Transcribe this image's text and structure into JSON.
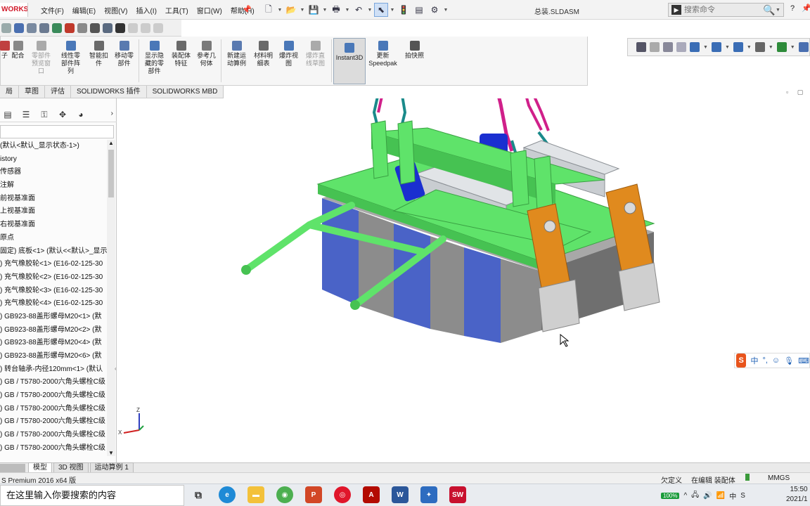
{
  "app": {
    "logo": "WORKS",
    "doc_title": "总装.SLDASM"
  },
  "menu": [
    "文件(F)",
    "编辑(E)",
    "视图(V)",
    "插入(I)",
    "工具(T)",
    "窗口(W)",
    "帮助(H)"
  ],
  "command_search": {
    "placeholder": "搜索命令"
  },
  "help_label": "?",
  "ribbon": {
    "buttons": [
      {
        "label": "子",
        "disabled": false,
        "color": "#c04040"
      },
      {
        "label": "配合",
        "disabled": false,
        "color": "#888888"
      },
      {
        "label": "零部件\n预览窗\n口",
        "disabled": true,
        "color": "#aaaaaa"
      },
      {
        "label": "线性零\n部件阵\n列",
        "disabled": false,
        "color": "#4a78b8"
      },
      {
        "label": "智能扣\n件",
        "disabled": false,
        "color": "#6a6a6a"
      },
      {
        "label": "移动零\n部件",
        "disabled": false,
        "color": "#5a7ab0"
      },
      {
        "label": "显示隐\n藏的零\n部件",
        "disabled": false,
        "color": "#4a78b8"
      },
      {
        "label": "装配体\n特征",
        "disabled": false,
        "color": "#6a6a6a"
      },
      {
        "label": "参考几\n何体",
        "disabled": false,
        "color": "#7a7a7a"
      },
      {
        "label": "新建运\n动算例",
        "disabled": false,
        "color": "#5a7ab0"
      },
      {
        "label": "材料明\n细表",
        "disabled": false,
        "color": "#6a6a6a"
      },
      {
        "label": "爆炸视\n图",
        "disabled": false,
        "color": "#4a78b8"
      },
      {
        "label": "爆炸直\n线草图",
        "disabled": true,
        "color": "#aaaaaa"
      },
      {
        "label": "Instant3D",
        "disabled": false,
        "active": true,
        "color": "#4a78b8"
      },
      {
        "label": "更新\nSpeedpak",
        "disabled": false,
        "color": "#4a78b8"
      },
      {
        "label": "拍快照",
        "disabled": false,
        "color": "#555555"
      }
    ]
  },
  "cm_tabs": [
    "局",
    "草图",
    "评估",
    "SOLIDWORKS 插件",
    "SOLIDWORKS MBD"
  ],
  "feature_tree": [
    "(默认<默认_显示状态-1>)",
    "istory",
    "传感器",
    "注解",
    "前视基准面",
    "上视基准面",
    "右视基准面",
    "原点",
    "固定) 底板<1> (默认<<默认>_显示",
    ") 充气橡胶轮<1> (E16-02-125-30",
    ") 充气橡胶轮<2> (E16-02-125-30",
    ") 充气橡胶轮<3> (E16-02-125-30",
    ") 充气橡胶轮<4> (E16-02-125-30",
    ") GB923-88盖形螺母M20<1> (默",
    ") GB923-88盖形螺母M20<2> (默",
    ") GB923-88盖形螺母M20<4> (默",
    ") GB923-88盖形螺母M20<6> (默",
    ") 转台轴承-内径120mm<1> (默认",
    ") GB / T5780-2000六角头螺栓C级",
    ") GB / T5780-2000六角头螺栓C级",
    ") GB / T5780-2000六角头螺栓C级",
    ") GB / T5780-2000六角头螺栓C级",
    ") GB / T5780-2000六角头螺栓C级",
    ") GB / T5780-2000六角头螺栓C级"
  ],
  "triad_labels": {
    "z": "Z",
    "x": "X"
  },
  "ime": {
    "logo": "S",
    "mode": "中",
    "punct": "°,"
  },
  "bottom_tabs": [
    {
      "label": "模型",
      "active": true
    },
    {
      "label": "3D 视图",
      "active": false
    },
    {
      "label": "运动算例 1",
      "active": false
    }
  ],
  "status": {
    "product": "S Premium 2016 x64 版",
    "under_defined": "欠定义",
    "editing": "在编辑 装配体",
    "units": "MMGS"
  },
  "taskbar": {
    "search_placeholder": "在这里输入你要搜索的内容",
    "battery": "100%",
    "time": "15:50",
    "date": "2021/1"
  },
  "colors": {
    "frame_green": "#5fe36a",
    "motor_blue": "#1a2fd0",
    "block_blue": "#4a63c7",
    "block_gray": "#8c8c8c",
    "bracket_orange": "#e08a1e",
    "chain_magenta": "#d0208a",
    "chain_teal": "#1a8a8a"
  }
}
